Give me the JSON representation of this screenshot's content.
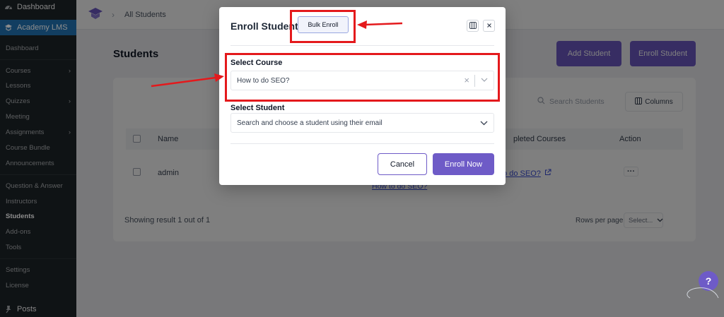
{
  "sidebar": {
    "top_items": [
      {
        "label": "Dashboard",
        "icon": "dashboard-icon"
      },
      {
        "label": "Academy LMS",
        "icon": "academy-icon"
      }
    ],
    "items": [
      {
        "label": "Dashboard",
        "has_submenu": false
      },
      {
        "label": "Courses",
        "has_submenu": true
      },
      {
        "label": "Lessons",
        "has_submenu": false
      },
      {
        "label": "Quizzes",
        "has_submenu": true
      },
      {
        "label": "Meeting",
        "has_submenu": false
      },
      {
        "label": "Assignments",
        "has_submenu": true
      },
      {
        "label": "Course Bundle",
        "has_submenu": false
      },
      {
        "label": "Announcements",
        "has_submenu": false
      },
      {
        "label": "Question & Answer",
        "has_submenu": false
      },
      {
        "label": "Instructors",
        "has_submenu": false
      },
      {
        "label": "Students",
        "has_submenu": false,
        "current": true
      },
      {
        "label": "Add-ons",
        "has_submenu": false
      },
      {
        "label": "Tools",
        "has_submenu": false
      },
      {
        "label": "Settings",
        "has_submenu": false
      },
      {
        "label": "License",
        "has_submenu": false
      }
    ],
    "bottom_item": {
      "label": "Posts",
      "icon": "pin-icon"
    }
  },
  "topbar": {
    "breadcrumb": "All Students"
  },
  "page": {
    "title": "Students",
    "add_student_label": "Add Student",
    "enroll_student_label": "Enroll Student",
    "search_placeholder": "Search Students",
    "columns_label": "Columns",
    "headers": {
      "name": "Name",
      "completed_courses": "pleted Courses",
      "action": "Action"
    },
    "row": {
      "name": "admin",
      "completed_course_link": "to do SEO?",
      "course_link": "How to do SEO?",
      "action": "···"
    },
    "showing": "Showing result 1 out of 1",
    "rows_per_page_label": "Rows per page",
    "rows_per_page_value": "Select..."
  },
  "modal": {
    "title": "Enroll Student",
    "bulk_enroll_label": "Bulk Enroll",
    "select_course_label": "Select Course",
    "select_course_value": "How to do SEO?",
    "select_student_label": "Select Student",
    "select_student_placeholder": "Search and choose a student using their email",
    "cancel_label": "Cancel",
    "enroll_now_label": "Enroll Now"
  },
  "help_label": "?",
  "colors": {
    "accent": "#6e5bc7",
    "sidebar_bg": "#1d2327",
    "sidebar_active": "#2271b1",
    "annotation_red": "#e4191c"
  }
}
